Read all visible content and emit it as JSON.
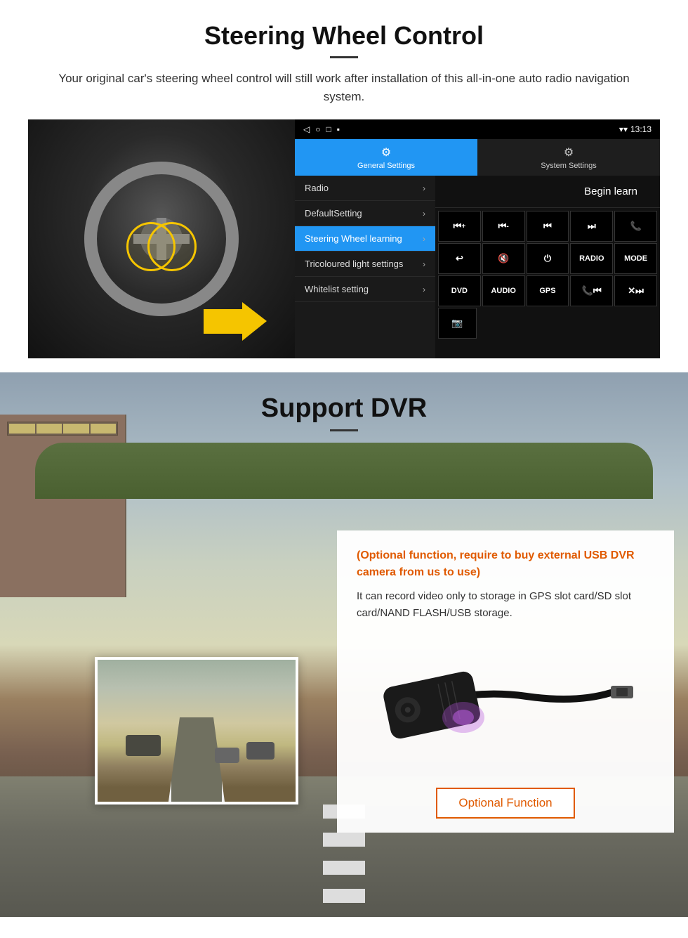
{
  "steering_section": {
    "title": "Steering Wheel Control",
    "subtitle": "Your original car's steering wheel control will still work after installation of this all-in-one auto radio navigation system.",
    "statusbar": {
      "time": "13:13",
      "icons_left": [
        "◁",
        "○",
        "□",
        "▪"
      ],
      "signal": "▼"
    },
    "tabs": [
      {
        "id": "general",
        "icon": "⚙",
        "label": "General Settings",
        "active": true
      },
      {
        "id": "system",
        "icon": "🔧",
        "label": "System Settings",
        "active": false
      }
    ],
    "menu_items": [
      {
        "label": "Radio",
        "selected": false
      },
      {
        "label": "DefaultSetting",
        "selected": false
      },
      {
        "label": "Steering Wheel learning",
        "selected": true
      },
      {
        "label": "Tricoloured light settings",
        "selected": false
      },
      {
        "label": "Whitelist setting",
        "selected": false
      }
    ],
    "begin_learn": "Begin learn",
    "control_buttons_row1": [
      "⏮+",
      "⏮-",
      "⏮",
      "⏭",
      "📞"
    ],
    "control_buttons_row2": [
      "↩",
      "🔇",
      "⏻",
      "RADIO",
      "MODE"
    ],
    "control_buttons_row3": [
      "DVD",
      "AUDIO",
      "GPS",
      "📞⏮",
      "✕⏭"
    ],
    "control_buttons_row4": [
      "📷"
    ]
  },
  "dvr_section": {
    "title": "Support DVR",
    "optional_text": "(Optional function, require to buy external USB DVR camera from us to use)",
    "description": "It can record video only to storage in GPS slot card/SD slot card/NAND FLASH/USB storage.",
    "optional_function_label": "Optional Function"
  }
}
